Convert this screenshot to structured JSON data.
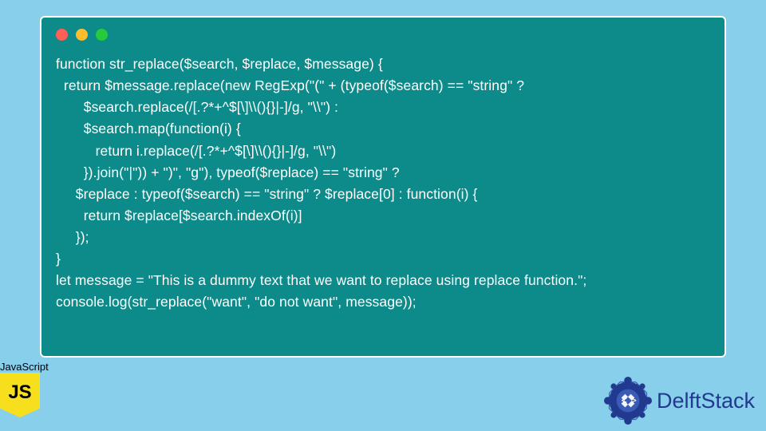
{
  "code_window": {
    "lines": [
      "function str_replace($search, $replace, $message) {",
      "  return $message.replace(new RegExp(\"(\" + (typeof($search) == \"string\" ?",
      "       $search.replace(/[.?*+^$[\\]\\\\(){}|-]/g, \"\\\\\") :",
      "       $search.map(function(i) {",
      "          return i.replace(/[.?*+^$[\\]\\\\(){}|-]/g, \"\\\\\")",
      "       }).join(\"|\")) + \")\", \"g\"), typeof($replace) == \"string\" ?",
      "     $replace : typeof($search) == \"string\" ? $replace[0] : function(i) {",
      "       return $replace[$search.indexOf(i)]",
      "     });",
      "}",
      "let message = \"This is a dummy text that we want to replace using replace function.\";",
      "console.log(str_replace(\"want\", \"do not want\", message));"
    ]
  },
  "js_badge": {
    "label": "JavaScript",
    "logo_text": "JS"
  },
  "brand": {
    "name": "DelftStack"
  }
}
